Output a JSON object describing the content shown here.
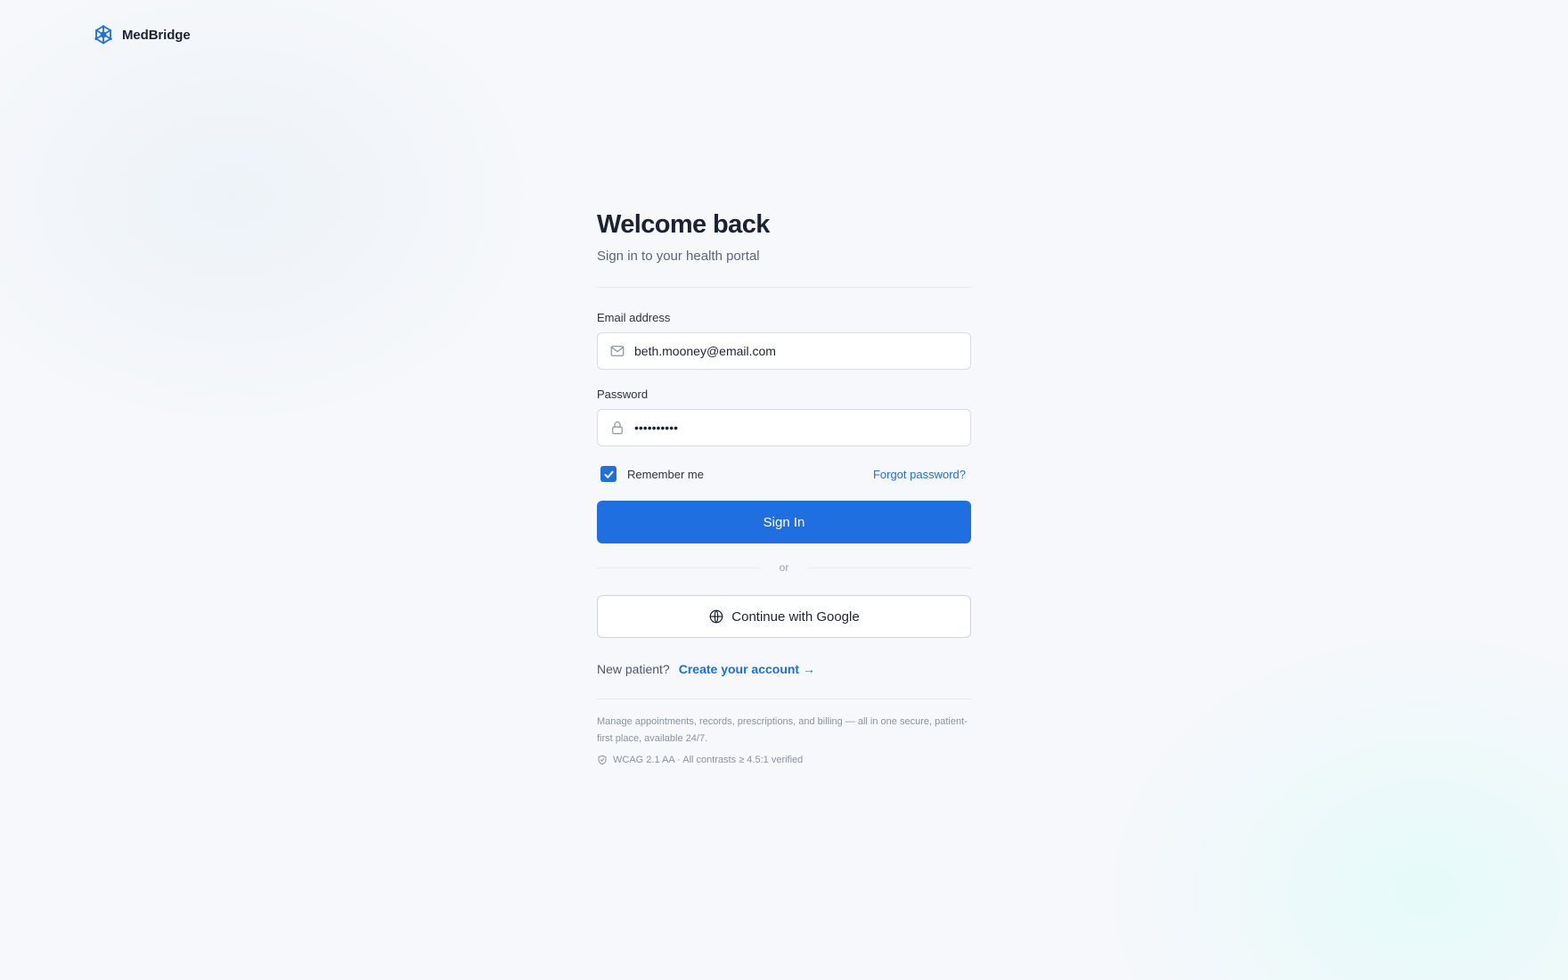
{
  "brand": {
    "name": "MedBridge",
    "logo_icon": "medbridge-logo-icon",
    "accent_color": "#1f6fe0"
  },
  "login": {
    "title": "Welcome back",
    "subtitle": "Sign in to your health portal",
    "email": {
      "label": "Email address",
      "value": "beth.mooney@email.com",
      "icon": "mail-icon"
    },
    "password": {
      "label": "Password",
      "value": "••••••••••",
      "icon": "lock-icon"
    },
    "remember": {
      "label": "Remember me",
      "checked": true
    },
    "forgot_label": "Forgot password?",
    "signin_label": "Sign In",
    "or_label": "or",
    "google_label": "Continue with Google",
    "google_icon": "globe-icon",
    "new_patient_text": "New patient?",
    "create_account_label": "Create your account →"
  },
  "footer": {
    "description": "Manage appointments, records, prescriptions, and billing — all in one secure, patient-first place, available 24/7.",
    "wcag_text": "WCAG 2.1 AA · All contrasts ≥ 4.5:1 verified",
    "wcag_icon": "shield-icon"
  }
}
